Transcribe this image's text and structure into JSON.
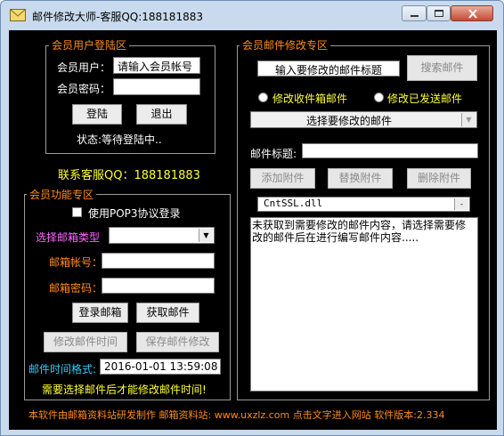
{
  "window": {
    "title": "邮件修改大师-客服QQ:188181883"
  },
  "login_panel": {
    "legend": "会员用户登陆区",
    "username_label": "会员用户：",
    "username_value": "请输入会员帐号",
    "password_label": "会员密码：",
    "password_value": "",
    "login_button": "登陆",
    "logout_button": "退出",
    "status": "状态:等待登陆中.."
  },
  "contact": "联系客服QQ：188181883",
  "member_panel": {
    "legend": "会员功能专区",
    "pop3_label": "使用POP3协议登录",
    "pop3_checked": false,
    "mailbox_type_label": "选择邮箱类型",
    "mailbox_type_value": "",
    "account_label": "邮箱帐号：",
    "account_value": "",
    "password_label": "邮箱密码：",
    "password_value": "",
    "login_mailbox_button": "登录邮箱",
    "fetch_mail_button": "获取邮件",
    "modify_time_button": "修改邮件时间",
    "save_modify_button": "保存邮件修改",
    "time_format_label": "邮件时间格式:",
    "time_format_value": "2016-01-01 13:59:08",
    "hint": "需要选择邮件后才能修改邮件时间!"
  },
  "modify_panel": {
    "legend": "会员邮件修改专区",
    "search_input_value": "输入要修改的邮件标题",
    "search_button": "搜索邮件",
    "radio_inbox": "修改收件箱邮件",
    "radio_sent": "修改已发送邮件",
    "select_mail_value": "选择要修改的邮件",
    "subject_label": "邮件标题:",
    "subject_value": "",
    "add_attachment_button": "添加附件",
    "replace_attachment_button": "替换附件",
    "delete_attachment_button": "删除附件",
    "attachment_value": "CntSSL.dll",
    "content_text": "未获取到需要修改的邮件内容，请选择需要修改的邮件后在进行编写邮件内容....."
  },
  "footer": "本软件由邮箱资料站研发制作 邮箱资料站: www.uxzlz.com 点击文字进入网站 软件版本:2.334",
  "colors": {
    "background": "#000000",
    "frame": "#c9daee",
    "orange": "#ff8c1a",
    "yellow": "#ffff33",
    "pink": "#ff66ff",
    "cyan": "#33ccff"
  },
  "icons": {
    "app": "envelope-icon",
    "minimize": "minimize-icon",
    "maximize": "maximize-icon",
    "close": "close-icon",
    "dropdown": "chevron-down-icon"
  }
}
